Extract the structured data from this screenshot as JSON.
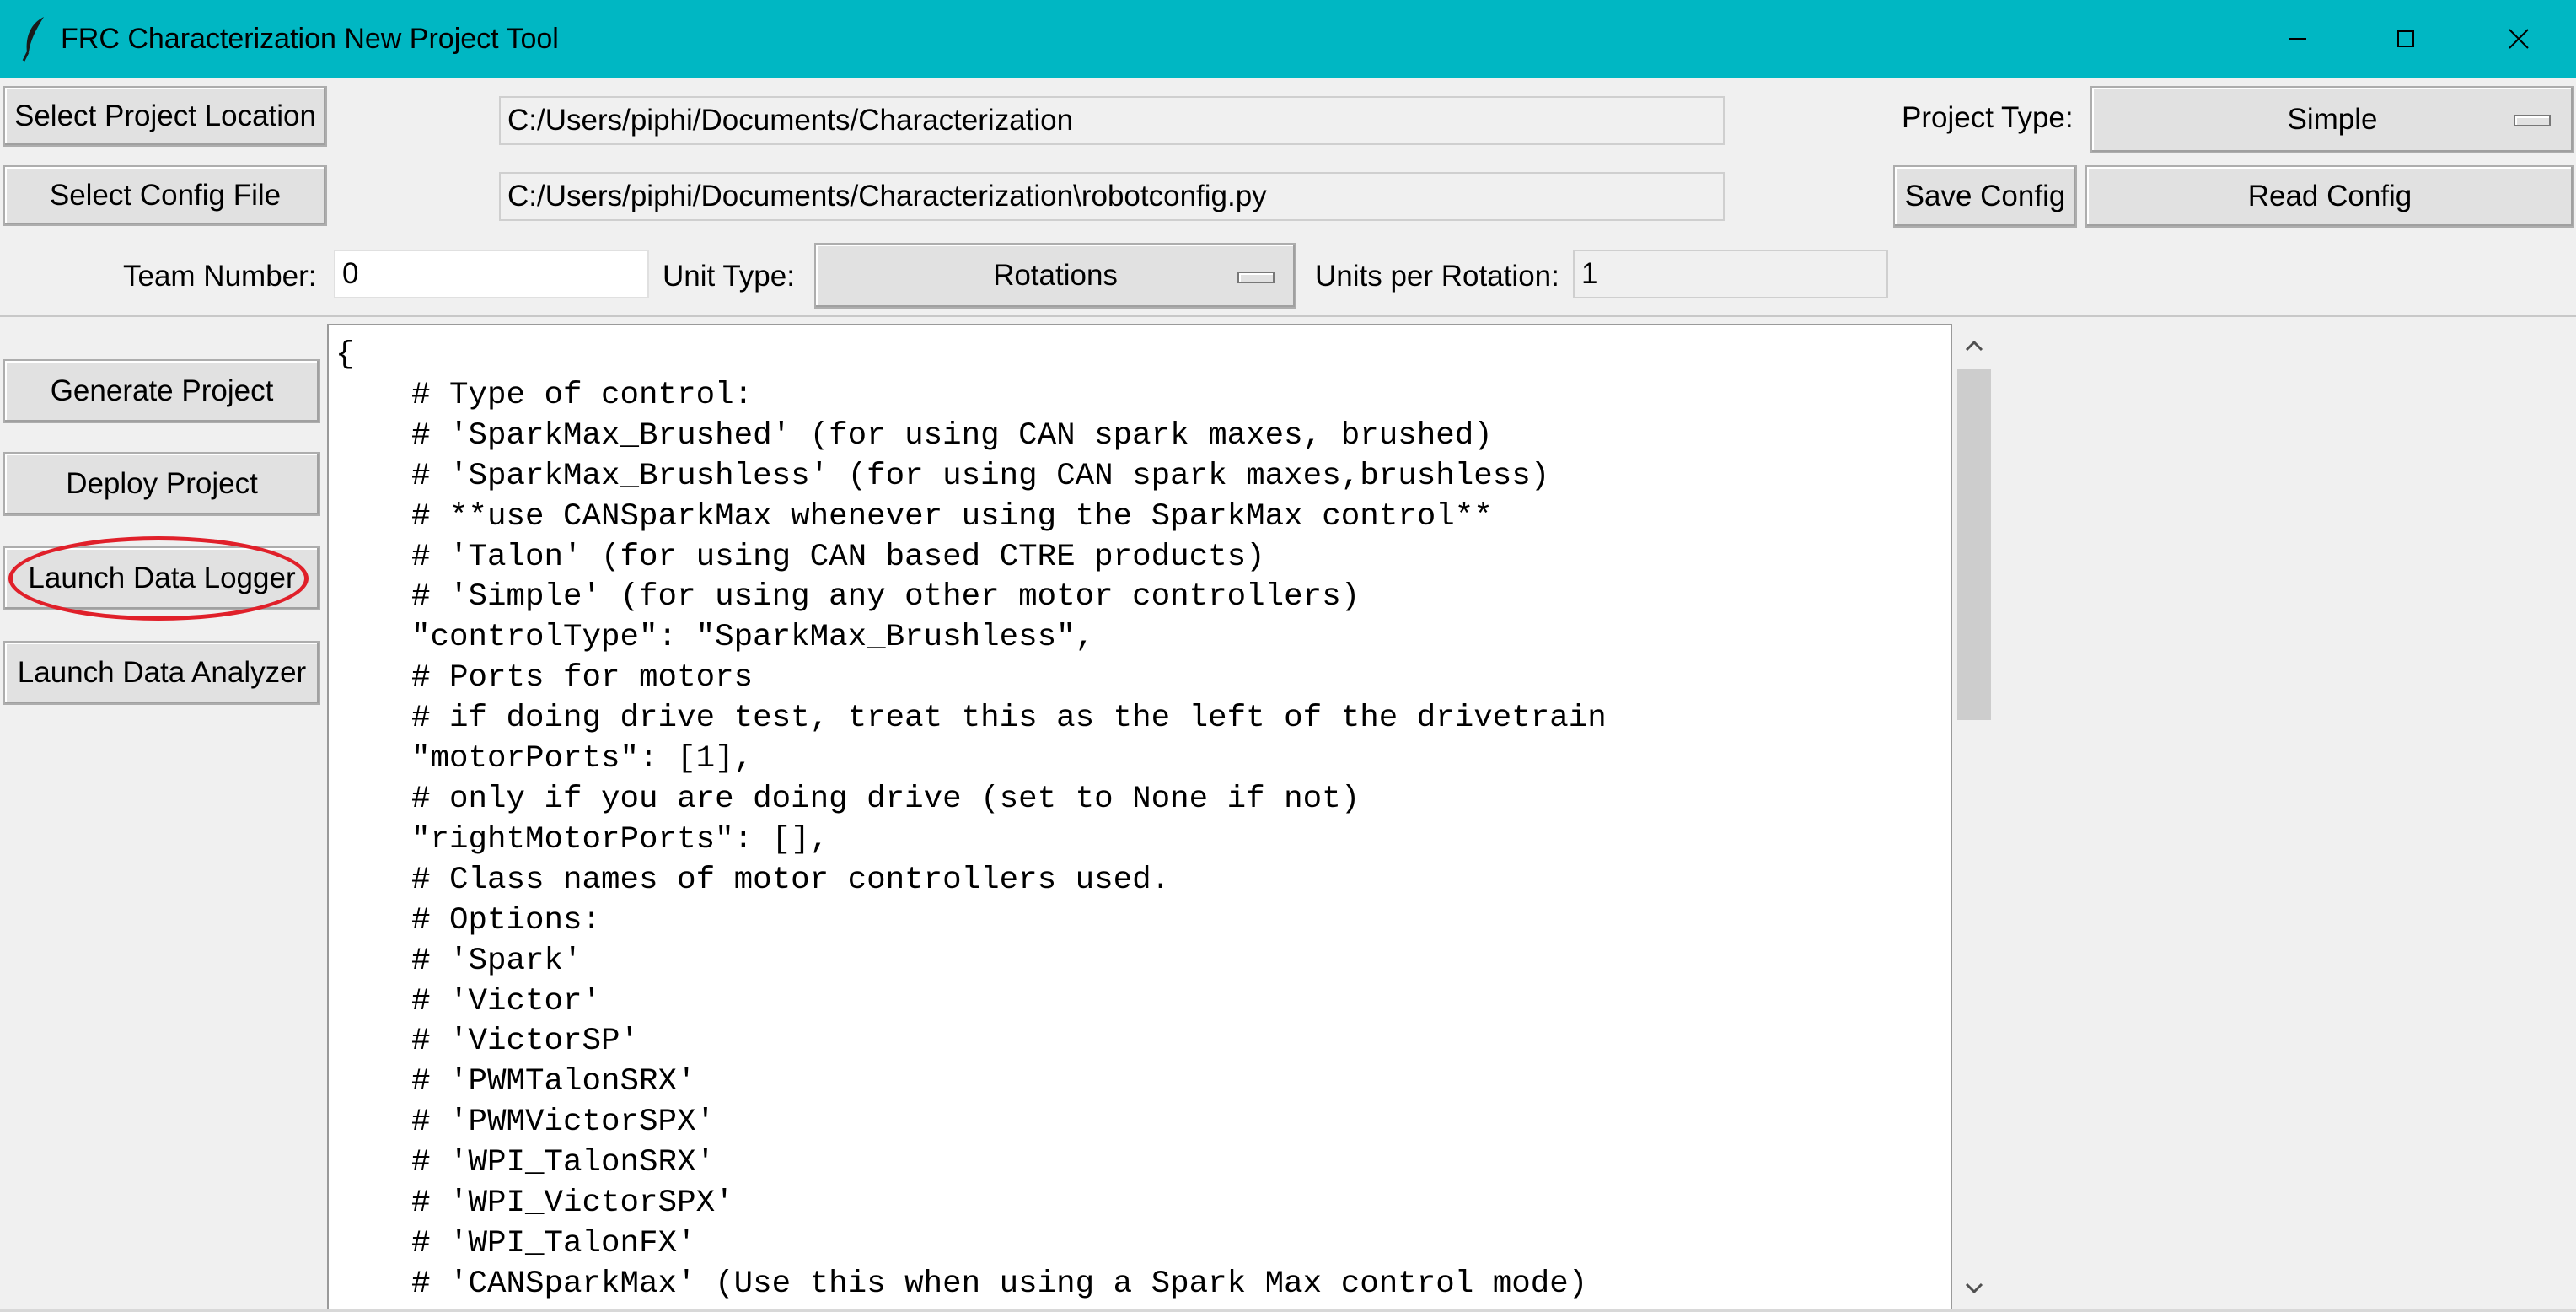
{
  "window": {
    "title": "FRC Characterization New Project Tool",
    "icons": {
      "app": "feather-icon",
      "minimize": "minimize-icon",
      "maximize": "maximize-icon",
      "close": "close-icon"
    }
  },
  "toolbar": {
    "select_project_location": "Select Project Location",
    "project_location_value": "C:/Users/piphi/Documents/Characterization",
    "project_type_label": "Project Type:",
    "project_type_value": "Simple",
    "select_config_file": "Select Config File",
    "config_file_value": "C:/Users/piphi/Documents/Characterization\\robotconfig.py",
    "save_config": "Save Config",
    "read_config": "Read Config",
    "team_number_label": "Team Number:",
    "team_number_value": "0",
    "unit_type_label": "Unit Type:",
    "unit_type_value": "Rotations",
    "units_per_rotation_label": "Units per Rotation:",
    "units_per_rotation_value": "1"
  },
  "sidebar": {
    "generate_project": "Generate Project",
    "deploy_project": "Deploy Project",
    "launch_data_logger": "Launch Data Logger",
    "launch_data_analyzer": "Launch Data Analyzer"
  },
  "annotation": {
    "highlight_color": "#e0202a"
  },
  "editor": {
    "content": "{\n    # Type of control:\n    # 'SparkMax_Brushed' (for using CAN spark maxes, brushed)\n    # 'SparkMax_Brushless' (for using CAN spark maxes,brushless)\n    # **use CANSparkMax whenever using the SparkMax control**\n    # 'Talon' (for using CAN based CTRE products)\n    # 'Simple' (for using any other motor controllers)\n    \"controlType\": \"SparkMax_Brushless\",\n    # Ports for motors\n    # if doing drive test, treat this as the left of the drivetrain\n    \"motorPorts\": [1],\n    # only if you are doing drive (set to None if not)\n    \"rightMotorPorts\": [],\n    # Class names of motor controllers used.\n    # Options:\n    # 'Spark'\n    # 'Victor'\n    # 'VictorSP'\n    # 'PWMTalonSRX'\n    # 'PWMVictorSPX'\n    # 'WPI_TalonSRX'\n    # 'WPI_VictorSPX'\n    # 'WPI_TalonFX'\n    # 'CANSparkMax' (Use this when using a Spark Max control mode)"
  }
}
